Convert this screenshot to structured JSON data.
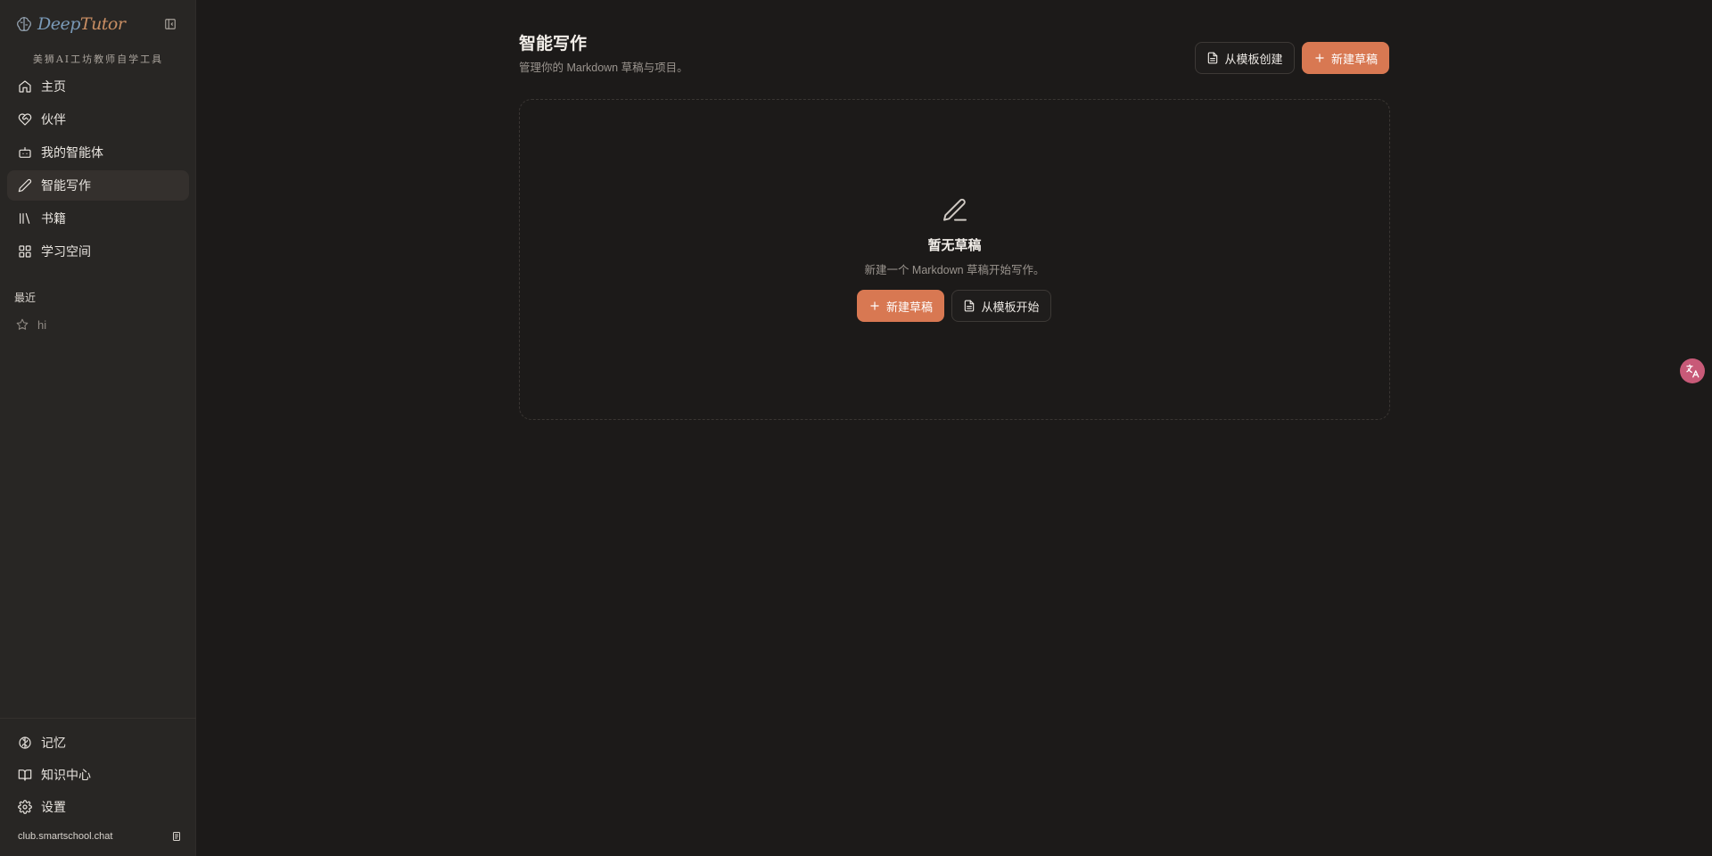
{
  "brand": {
    "name_part1": "Deep",
    "name_part2": "Tutor",
    "tagline": "美狮AI工坊教师自学工具"
  },
  "sidebar": {
    "nav": [
      {
        "label": "主页",
        "icon": "home-icon"
      },
      {
        "label": "伙伴",
        "icon": "heart-handshake-icon"
      },
      {
        "label": "我的智能体",
        "icon": "bot-icon"
      },
      {
        "label": "智能写作",
        "icon": "pen-icon",
        "active": true
      },
      {
        "label": "书籍",
        "icon": "library-icon"
      },
      {
        "label": "学习空间",
        "icon": "grid-icon"
      }
    ],
    "recent_label": "最近",
    "recent": [
      {
        "label": "hi",
        "icon": "star-icon"
      }
    ],
    "bottom": [
      {
        "label": "记忆",
        "icon": "brain-icon"
      },
      {
        "label": "知识中心",
        "icon": "book-open-icon"
      },
      {
        "label": "设置",
        "icon": "gear-icon"
      }
    ],
    "domain": "club.smartschool.chat"
  },
  "header": {
    "title": "智能写作",
    "subtitle": "管理你的 Markdown 草稿与项目。",
    "from_template_label": "从模板创建",
    "new_draft_label": "新建草稿"
  },
  "empty_state": {
    "title": "暂无草稿",
    "subtitle": "新建一个 Markdown 草稿开始写作。",
    "new_draft_label": "新建草稿",
    "from_template_label": "从模板开始"
  },
  "colors": {
    "accent": "#d87852",
    "background": "#1c1a19",
    "sidebar": "#282624",
    "fab": "#c85a78"
  }
}
